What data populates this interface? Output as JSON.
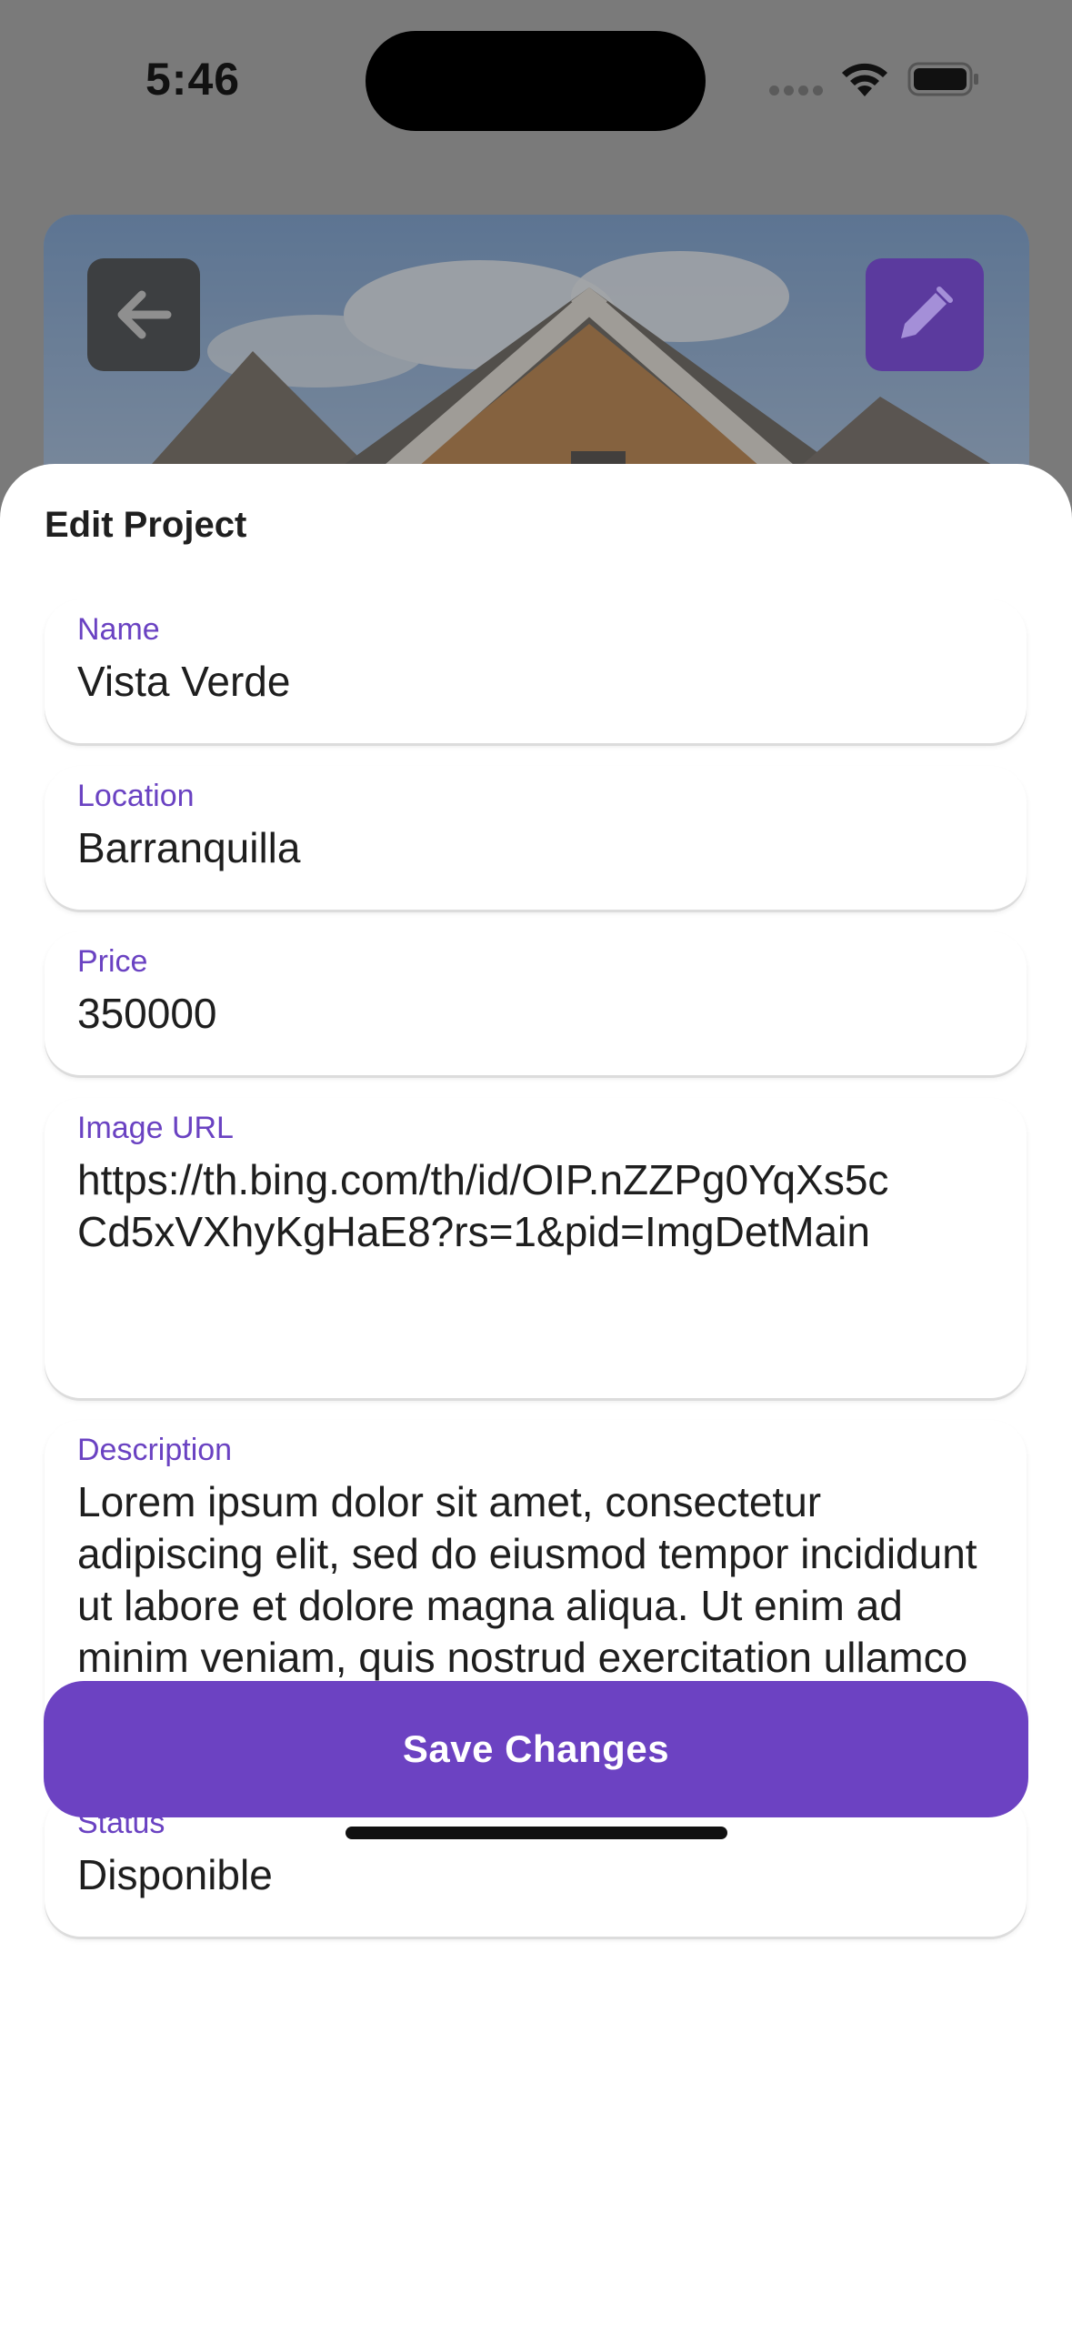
{
  "status_bar": {
    "time": "5:46"
  },
  "header": {
    "back_icon": "arrow-left-icon",
    "edit_icon": "pencil-icon",
    "accent_color": "#6c42c2"
  },
  "sheet": {
    "title": "Edit Project",
    "fields": {
      "name": {
        "label": "Name",
        "value": "Vista Verde"
      },
      "location": {
        "label": "Location",
        "value": "Barranquilla"
      },
      "price": {
        "label": "Price",
        "value": "350000"
      },
      "image_url": {
        "label": "Image URL",
        "value": "https://th.bing.com/th/id/OIP.nZZPg0YqXs5cCd5xVXhyKgHaE8?rs=1&pid=ImgDetMain"
      },
      "description": {
        "label": "Description",
        "value": "Lorem ipsum dolor sit amet, consectetur adipiscing elit, sed do eiusmod tempor incididunt ut labore et dolore magna aliqua. Ut enim ad minim veniam, quis nostrud exercitation ullamco laboris nisi ut aliquip ex"
      },
      "status": {
        "label": "Status",
        "value": "Disponible"
      }
    },
    "save_label": "Save Changes"
  }
}
